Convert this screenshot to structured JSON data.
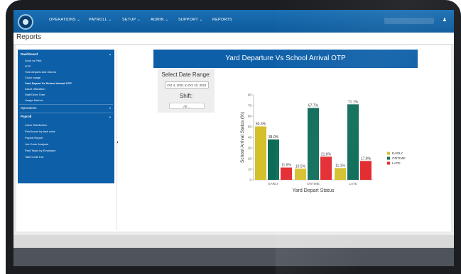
{
  "nav": {
    "items": [
      "OPERATIONS",
      "PAYROLL",
      "SETUP",
      "ADMIN",
      "SUPPORT",
      "REPORTS"
    ],
    "user_icon": "user-icon"
  },
  "page_title": "Reports",
  "sidebar": {
    "sections": [
      {
        "label": "Dashboard",
        "items": [
          "Schd vs Paid",
          "OTP",
          "Yard departs and returns",
          "Clock usage",
          "Yard Depart Vs School Arrival OTP",
          "Asset Utilization",
          "Staff Drive Time",
          "Usage Metrics"
        ]
      },
      {
        "label": "Operations",
        "items": []
      },
      {
        "label": "Payroll",
        "items": [
          "Labor Distribution",
          "Paid hours by task code",
          "Payroll Report",
          "Job Code Analysis",
          "Paid Tasks by Employee",
          "Task Code List"
        ]
      }
    ],
    "active_item": "Yard Depart Vs School Arrival OTP"
  },
  "report": {
    "title": "Yard Departure Vs School Arrival OTP",
    "date_range_label": "Select Date Range:",
    "date_range_value": "Oct 4, 2021 to Oct 10, 2021",
    "shift_label": "Shift:",
    "shift_value": "All"
  },
  "colors": {
    "nav": "#0d5fa8",
    "early": "#d4c02b",
    "ontime": "#0b6b57",
    "late": "#e2272d"
  },
  "chart_data": {
    "type": "bar",
    "categories": [
      "EARLY",
      "ONTIME",
      "LATE"
    ],
    "series": [
      {
        "name": "EARLY",
        "values": [
          50.3,
          10.5,
          11.1
        ]
      },
      {
        "name": "ONTIME",
        "values": [
          38.0,
          67.7,
          71.1
        ]
      },
      {
        "name": "LATE",
        "values": [
          11.6,
          21.8,
          17.8
        ]
      }
    ],
    "data_labels": [
      [
        "50.3%",
        "38.0%",
        "11.6%"
      ],
      [
        "10.5%",
        "67.7%",
        "21.8%"
      ],
      [
        "11.1%",
        "71.1%",
        "17.8%"
      ]
    ],
    "xlabel": "Yard Depart Status",
    "ylabel": "School Arrival Status (%)",
    "ylim": [
      0,
      80
    ],
    "yticks": [
      0,
      10,
      20,
      30,
      40,
      50,
      60,
      70,
      80
    ],
    "legend": [
      "EARLY",
      "ONTIME",
      "LATE"
    ],
    "legend_position": "right",
    "grid": false
  }
}
